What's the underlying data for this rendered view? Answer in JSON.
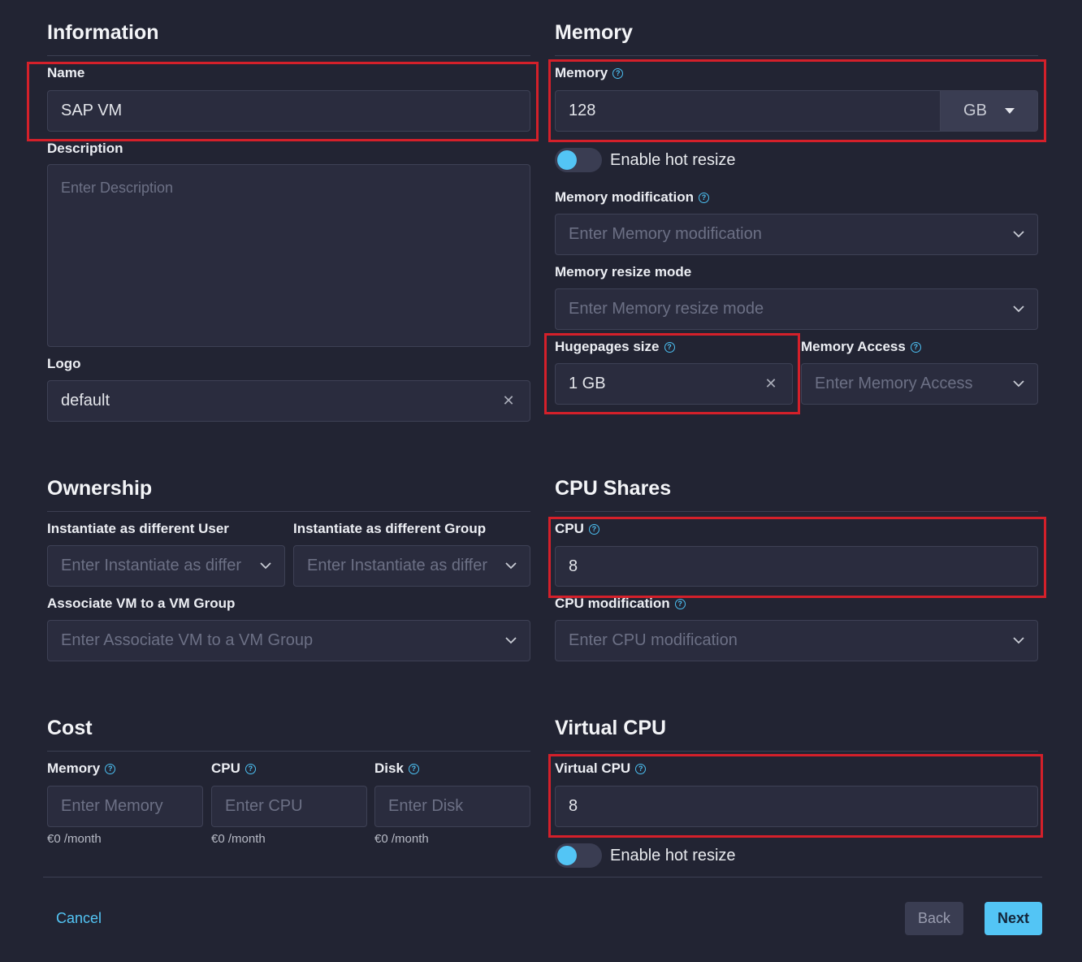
{
  "information": {
    "title": "Information",
    "name_label": "Name",
    "name_value": "SAP VM",
    "description_label": "Description",
    "description_placeholder": "Enter Description",
    "logo_label": "Logo",
    "logo_value": "default"
  },
  "memory": {
    "title": "Memory",
    "memory_label": "Memory",
    "memory_value": "128",
    "memory_unit": "GB",
    "hot_resize_label": "Enable hot resize",
    "modification_label": "Memory modification",
    "modification_placeholder": "Enter Memory modification",
    "resize_mode_label": "Memory resize mode",
    "resize_mode_placeholder": "Enter Memory resize mode",
    "hugepages_label": "Hugepages size",
    "hugepages_value": "1 GB",
    "access_label": "Memory Access",
    "access_placeholder": "Enter Memory Access"
  },
  "ownership": {
    "title": "Ownership",
    "user_label": "Instantiate as different User",
    "user_placeholder": "Enter Instantiate as differ",
    "group_label": "Instantiate as different Group",
    "group_placeholder": "Enter Instantiate as differ",
    "vmgroup_label": "Associate VM to a VM Group",
    "vmgroup_placeholder": "Enter Associate VM to a VM Group"
  },
  "cpu_shares": {
    "title": "CPU Shares",
    "cpu_label": "CPU",
    "cpu_value": "8",
    "modification_label": "CPU modification",
    "modification_placeholder": "Enter CPU modification"
  },
  "cost": {
    "title": "Cost",
    "memory_label": "Memory",
    "memory_placeholder": "Enter Memory",
    "memory_price": "€0 /month",
    "cpu_label": "CPU",
    "cpu_placeholder": "Enter CPU",
    "cpu_price": "€0 /month",
    "disk_label": "Disk",
    "disk_placeholder": "Enter Disk",
    "disk_price": "€0 /month"
  },
  "virtual_cpu": {
    "title": "Virtual CPU",
    "vcpu_label": "Virtual CPU",
    "vcpu_value": "8",
    "hot_resize_label": "Enable hot resize"
  },
  "footer": {
    "cancel": "Cancel",
    "back": "Back",
    "next": "Next"
  },
  "colors": {
    "background": "#222433",
    "accent": "#53c5f5",
    "highlight": "#d4202a"
  },
  "icons": [
    "help-icon",
    "chevron-down-icon",
    "close-icon",
    "caret-down-icon"
  ]
}
